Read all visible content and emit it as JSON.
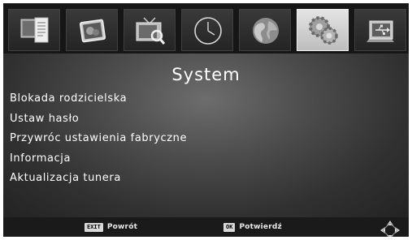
{
  "tabs": [
    {
      "icon": "document-tv-icon",
      "active": false
    },
    {
      "icon": "photo-frame-icon",
      "active": false
    },
    {
      "icon": "tv-search-icon",
      "active": false
    },
    {
      "icon": "clock-icon",
      "active": false
    },
    {
      "icon": "globe-icon",
      "active": false
    },
    {
      "icon": "gears-icon",
      "active": true
    },
    {
      "icon": "usb-icon",
      "active": false
    }
  ],
  "main": {
    "title": "System",
    "items": [
      {
        "label": "Blokada rodzicielska"
      },
      {
        "label": "Ustaw hasło"
      },
      {
        "label": "Przywróc ustawienia fabryczne"
      },
      {
        "label": "Informacja"
      },
      {
        "label": "Aktualizacja tunera"
      }
    ]
  },
  "footer": {
    "exit_key": "EXIT",
    "exit_label": "Powrót",
    "ok_key": "OK",
    "ok_label": "Potwierdź",
    "nav_icon": "navigation-arrows-icon"
  },
  "colors": {
    "active_tab": "#d4d4d4",
    "text": "#ffffff",
    "background": "#161616"
  }
}
